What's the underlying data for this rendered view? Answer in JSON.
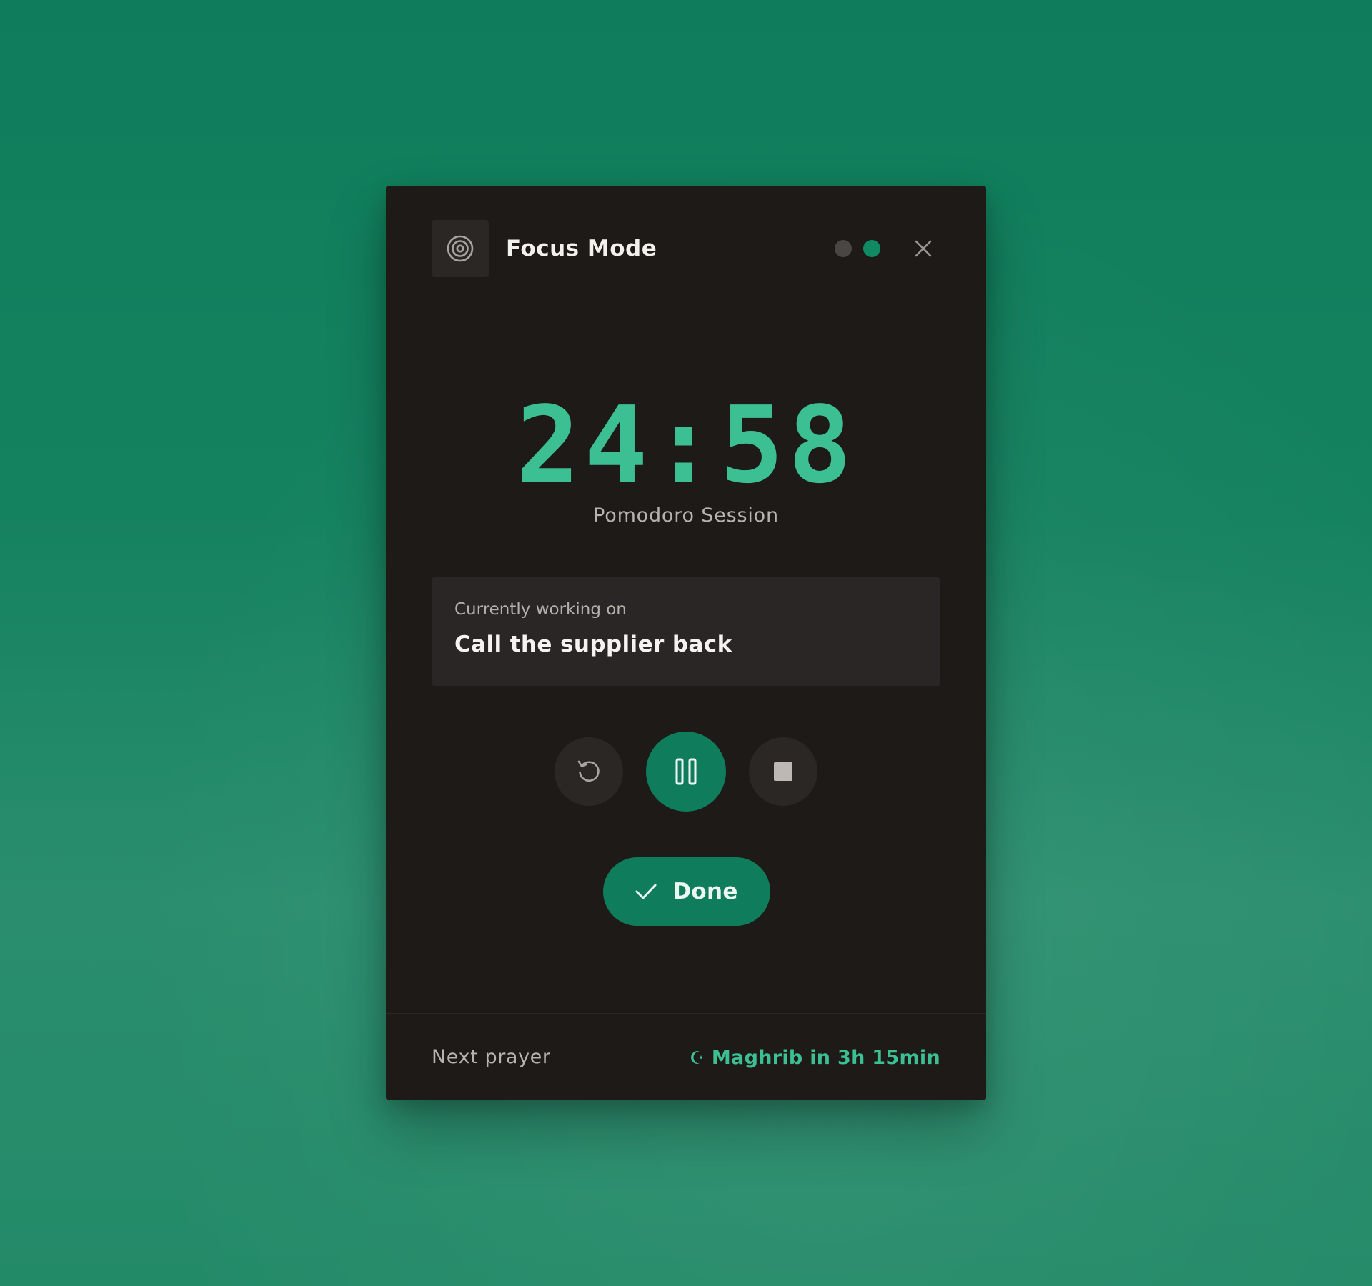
{
  "header": {
    "title": "Focus Mode",
    "logo_icon": "target-icon",
    "indicators": [
      {
        "name": "status-dot-inactive",
        "active": false
      },
      {
        "name": "status-dot-active",
        "active": true
      }
    ],
    "close_icon": "close-icon"
  },
  "timer": {
    "time": "24:58",
    "session_label": "Pomodoro Session"
  },
  "task": {
    "label": "Currently working on",
    "name": "Call the supplier back"
  },
  "controls": {
    "restart_icon": "restart-icon",
    "pause_icon": "pause-icon",
    "stop_icon": "stop-icon"
  },
  "done_button": {
    "label": "Done",
    "icon": "check-icon"
  },
  "footer": {
    "label": "Next prayer",
    "prayer_icon": "crescent-moon-icon",
    "next_prayer": "Maghrib in 3h 15min"
  },
  "colors": {
    "background": "#0f7d5b",
    "panel": "#1d1a18",
    "accent": "#3cc093",
    "button": "#0f7d5b"
  }
}
